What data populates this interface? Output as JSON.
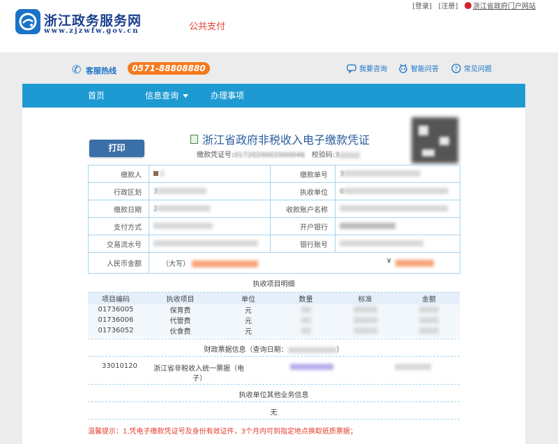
{
  "header": {
    "site_name": "浙江政务服务网",
    "site_url": "www.zjzwfw.gov.cn",
    "public_pay": "公共支付",
    "login": "[登录]",
    "register": "[注册]",
    "portal": "浙江省政府门户网站"
  },
  "service": {
    "hotline_label": "客服热线",
    "hotline_number": "0571-88808880",
    "consult": "我要咨询",
    "smart_qa": "智能问答",
    "faq": "常见问题"
  },
  "nav": {
    "home": "首页",
    "info_query": "信息查询",
    "affairs": "办理事项"
  },
  "voucher": {
    "print_button": "打印",
    "title": "浙江省政府非税收入电子缴款凭证",
    "voucher_no_label": "缴款凭证号:",
    "voucher_no_partial": "0172020002000046",
    "check_code_label": "校验码:",
    "check_code_partial": "3"
  },
  "info": {
    "payer_label": "缴款人",
    "payer_no_label": "缴款单号",
    "payer_no_partial": "3",
    "region_label": "行政区划",
    "region_partial": "3",
    "exec_unit_label": "执收单位",
    "exec_unit_partial": "0",
    "pay_date_label": "缴款日期",
    "pay_date_partial": "2",
    "account_name_label": "收款账户名称",
    "pay_method_label": "支付方式",
    "bank_label": "开户银行",
    "txn_label": "交易流水号",
    "account_no_label": "银行账号",
    "rmb_label": "人民币金额",
    "rmb_upper": "（大写）",
    "rmb_symbol": "¥"
  },
  "items": {
    "section_title": "执收项目明细",
    "headers": [
      "项目编码",
      "执收项目",
      "单位",
      "数量",
      "标准",
      "金额"
    ],
    "rows": [
      {
        "code": "01736005",
        "name": "保育费",
        "unit": "元"
      },
      {
        "code": "01736006",
        "name": "代管费",
        "unit": "元"
      },
      {
        "code": "01736052",
        "name": "伙食费",
        "unit": "元"
      }
    ]
  },
  "bill": {
    "section_title": "财政票据信息（查询日期：",
    "section_title_end": "）",
    "code": "33010120",
    "name_line1": "浙江省非税收入统一票据（电",
    "name_line2": "子）"
  },
  "other": {
    "section_title": "执收单位其他业务信息",
    "value": "无"
  },
  "warning": "温馨提示：1.凭电子缴款凭证号及身份有效证件，3个月内可到指定地点换取纸质票据；"
}
